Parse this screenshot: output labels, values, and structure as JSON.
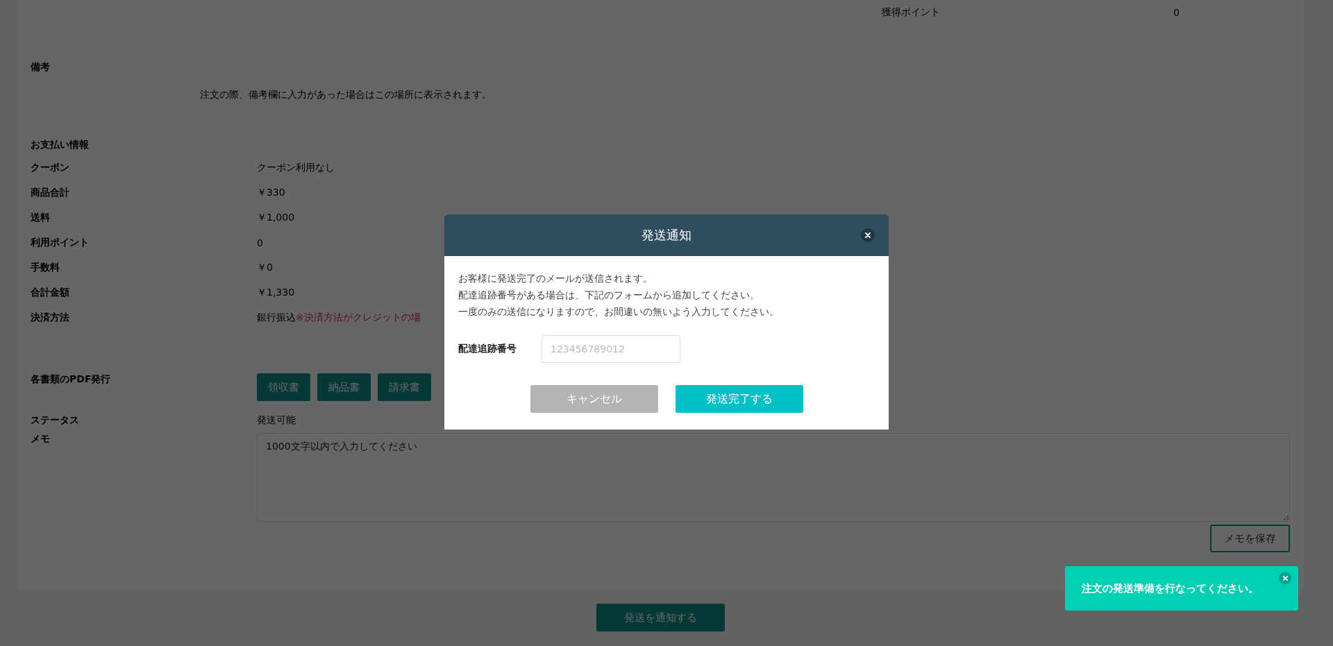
{
  "points_row": {
    "label": "獲得ポイント",
    "value": "0"
  },
  "remarks": {
    "heading": "備考",
    "text": "注文の際、備考欄に入力があった場合はこの場所に表示されます。"
  },
  "payment": {
    "heading": "お支払い情報",
    "rows": [
      {
        "label": "クーポン",
        "value": "クーポン利用なし"
      },
      {
        "label": "商品合計",
        "value": "￥330"
      },
      {
        "label": "送料",
        "value": "￥1,000"
      },
      {
        "label": "利用ポイント",
        "value": "0"
      },
      {
        "label": "手数料",
        "value": "￥0"
      },
      {
        "label": "合計金額",
        "value": "￥1,330"
      }
    ],
    "method": {
      "label": "決済方法",
      "value": "銀行振込",
      "note": "※決済方法がクレジットの場"
    }
  },
  "pdf": {
    "label": "各書類のPDF発行",
    "buttons": [
      "領収書",
      "納品書",
      "請求書"
    ]
  },
  "status": {
    "label": "ステータス",
    "value": "発送可能"
  },
  "memo": {
    "label": "メモ",
    "placeholder": "1000文字以内で入力してください",
    "save_button": "メモを保存"
  },
  "notify_button": "発送を通知する",
  "modal": {
    "title": "発送通知",
    "lines": [
      "お客様に発送完了のメールが送信されます。",
      "配達追跡番号がある場合は、下記のフォームから追加してください。",
      "一度のみの送信になりますので、お間違いの無いよう入力してください。"
    ],
    "field": {
      "label": "配達追跡番号",
      "placeholder": "123456789012"
    },
    "buttons": [
      {
        "label": "キャンセル",
        "kind": "cancel"
      },
      {
        "label": "発送完了する",
        "kind": "primary"
      }
    ]
  },
  "toast": {
    "message": "注文の発送準備を行なってください。"
  }
}
